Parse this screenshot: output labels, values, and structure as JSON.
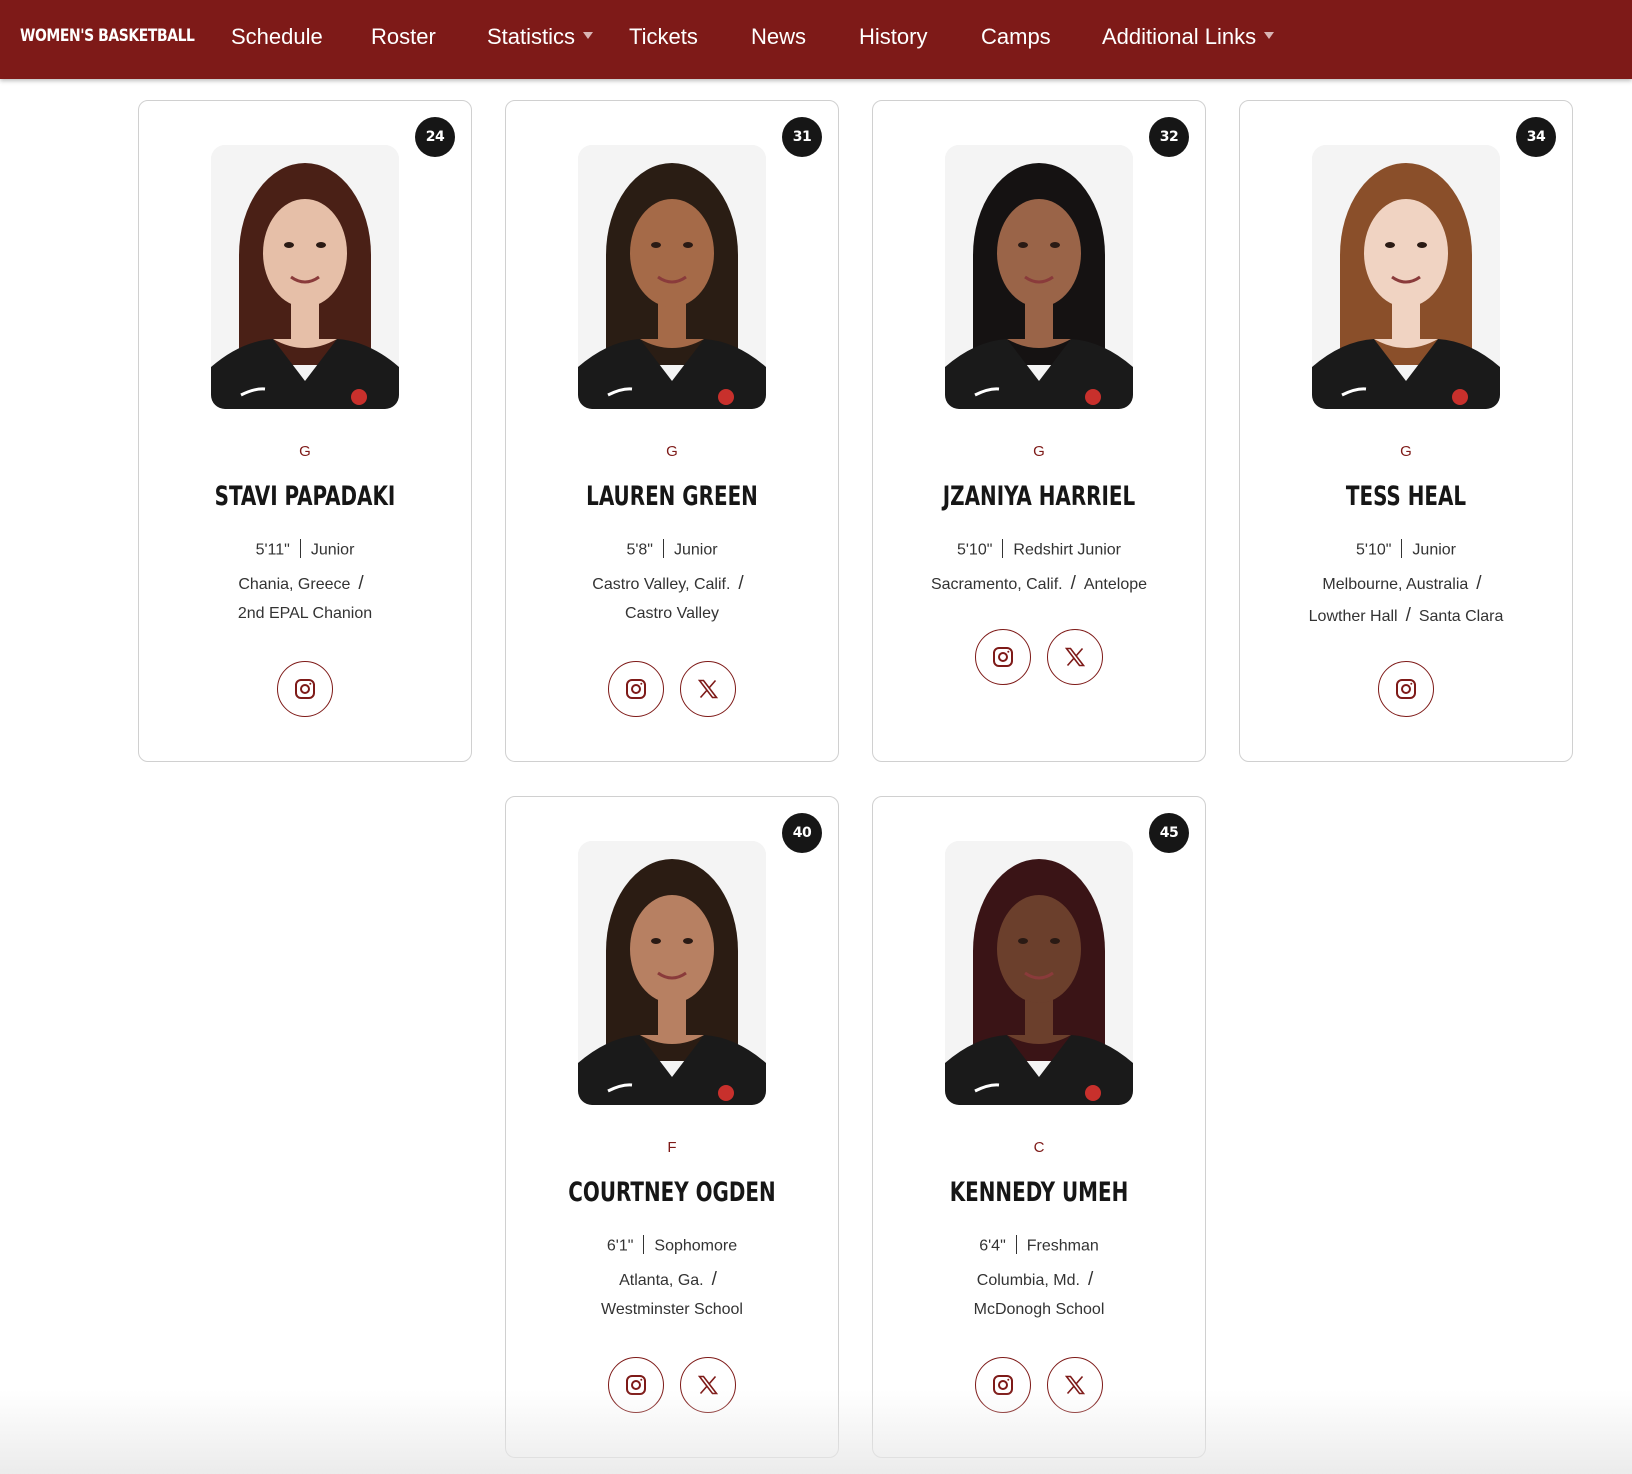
{
  "site": {
    "brand": "WOMEN'S BASKETBALL",
    "accent_color": "#7e1a18",
    "nav": [
      {
        "label": "Schedule",
        "has_dropdown": false
      },
      {
        "label": "Roster",
        "has_dropdown": false
      },
      {
        "label": "Statistics",
        "has_dropdown": true
      },
      {
        "label": "Tickets",
        "has_dropdown": false
      },
      {
        "label": "News",
        "has_dropdown": false
      },
      {
        "label": "History",
        "has_dropdown": false
      },
      {
        "label": "Camps",
        "has_dropdown": false
      },
      {
        "label": "Additional Links",
        "has_dropdown": true
      }
    ]
  },
  "players": [
    {
      "number": "24",
      "position": "G",
      "name": "Stavi Papadaki",
      "height": "5'11\"",
      "year": "Junior",
      "hometown": "Chania, Greece",
      "school": "2nd EPAL Chanion",
      "socials": [
        "instagram-icon"
      ],
      "hair_color": "#4a2016",
      "skin_color": "#e6bfa8"
    },
    {
      "number": "31",
      "position": "G",
      "name": "Lauren Green",
      "height": "5'8\"",
      "year": "Junior",
      "hometown": "Castro Valley, Calif.",
      "school": "Castro Valley",
      "socials": [
        "instagram-icon",
        "x-icon"
      ],
      "hair_color": "#2a1d14",
      "skin_color": "#a56a48"
    },
    {
      "number": "32",
      "position": "G",
      "name": "Jzaniya Harriel",
      "height": "5'10\"",
      "year": "Redshirt Junior",
      "hometown": "Sacramento, Calif.",
      "school": "Antelope",
      "socials": [
        "instagram-icon",
        "x-icon"
      ],
      "hair_color": "#151212",
      "skin_color": "#9a6448"
    },
    {
      "number": "34",
      "position": "G",
      "name": "Tess Heal",
      "height": "5'10\"",
      "year": "Junior",
      "hometown": "Melbourne, Australia",
      "school": "Lowther Hall",
      "school2": "Santa Clara",
      "socials": [
        "instagram-icon"
      ],
      "hair_color": "#8a4f2a",
      "skin_color": "#f0d3c2"
    },
    {
      "number": "40",
      "position": "F",
      "name": "Courtney Ogden",
      "height": "6'1\"",
      "year": "Sophomore",
      "hometown": "Atlanta, Ga.",
      "school": "Westminster School",
      "socials": [
        "instagram-icon",
        "x-icon"
      ],
      "hair_color": "#2b1c13",
      "skin_color": "#b78062"
    },
    {
      "number": "45",
      "position": "C",
      "name": "Kennedy Umeh",
      "height": "6'4\"",
      "year": "Freshman",
      "hometown": "Columbia, Md.",
      "school": "McDonogh School",
      "socials": [
        "instagram-icon",
        "x-icon"
      ],
      "hair_color": "#3a1416",
      "skin_color": "#6b3f2c"
    }
  ]
}
